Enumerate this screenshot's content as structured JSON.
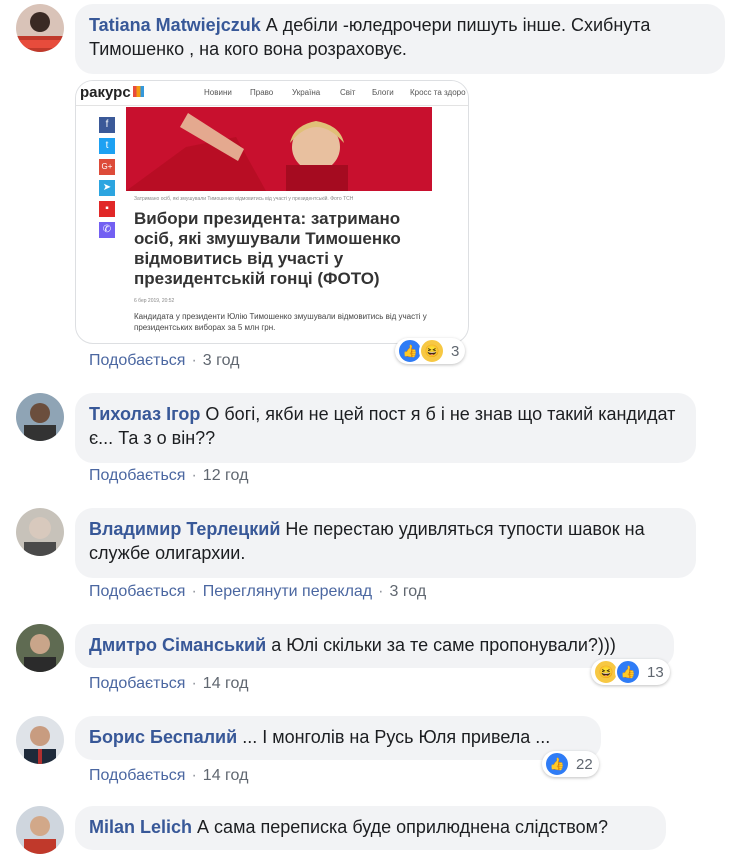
{
  "comments": [
    {
      "author": "Tatiana Matwiejczuk",
      "text": "А дебіли -юледрочери пишуть інше. Схибнута Тимошенко , на кого вона розраховує.",
      "like_label": "Подобається",
      "time": "3 год",
      "reaction_count": "3",
      "link_preview": {
        "site_name": "ракурс",
        "nav": [
          "Новини",
          "Право",
          "Україна",
          "Світ",
          "Блоги",
          "Кросс та здоро"
        ],
        "photo_caption": "Затримано осіб, які змушували Тимошенко відмовитись від участі у президентській. Фото ТСН",
        "headline": "Вибори президента: затримано осіб, які змушували Тимошенко відмовитись від участі у президентській гонці (ФОТО)",
        "date": "6 бер 2019, 20:52",
        "lead": "Кандидата у президенти Юлію Тимошенко змушували відмовитись від участі у президентських виборах за 5 млн грн."
      }
    },
    {
      "author": "Тихолаз Ігор",
      "text": "О богі, якби не цей пост я б і не знав що такий кандидат є... Та з о він??",
      "like_label": "Подобається",
      "time": "12 год"
    },
    {
      "author": "Владимир Терлецкий",
      "text": "Не перестаю удивляться тупости шавок на службе олигархии.",
      "like_label": "Подобається",
      "translate_label": "Переглянути переклад",
      "time": "3 год"
    },
    {
      "author": "Дмитро Сіманський",
      "text": "а Юлі скільки за те саме пропонували?)))",
      "like_label": "Подобається",
      "time": "14 год",
      "reaction_count": "13"
    },
    {
      "author": "Борис Беспалий",
      "text": "... І монголів на Русь Юля привела ...",
      "like_label": "Подобається",
      "time": "14 год",
      "reaction_count": "22"
    },
    {
      "author": "Milan Lelich",
      "text": "А сама переписка буде оприлюднена слідством?"
    }
  ],
  "icons": {
    "like": "thumbs-up-icon",
    "haha": "laughing-face-icon"
  },
  "colors": {
    "author_link": "#385898",
    "action_link": "#4b67a1",
    "bubble_bg": "#f2f3f5",
    "like_blue": "#2f7cf6",
    "haha_yellow": "#f7c843"
  }
}
